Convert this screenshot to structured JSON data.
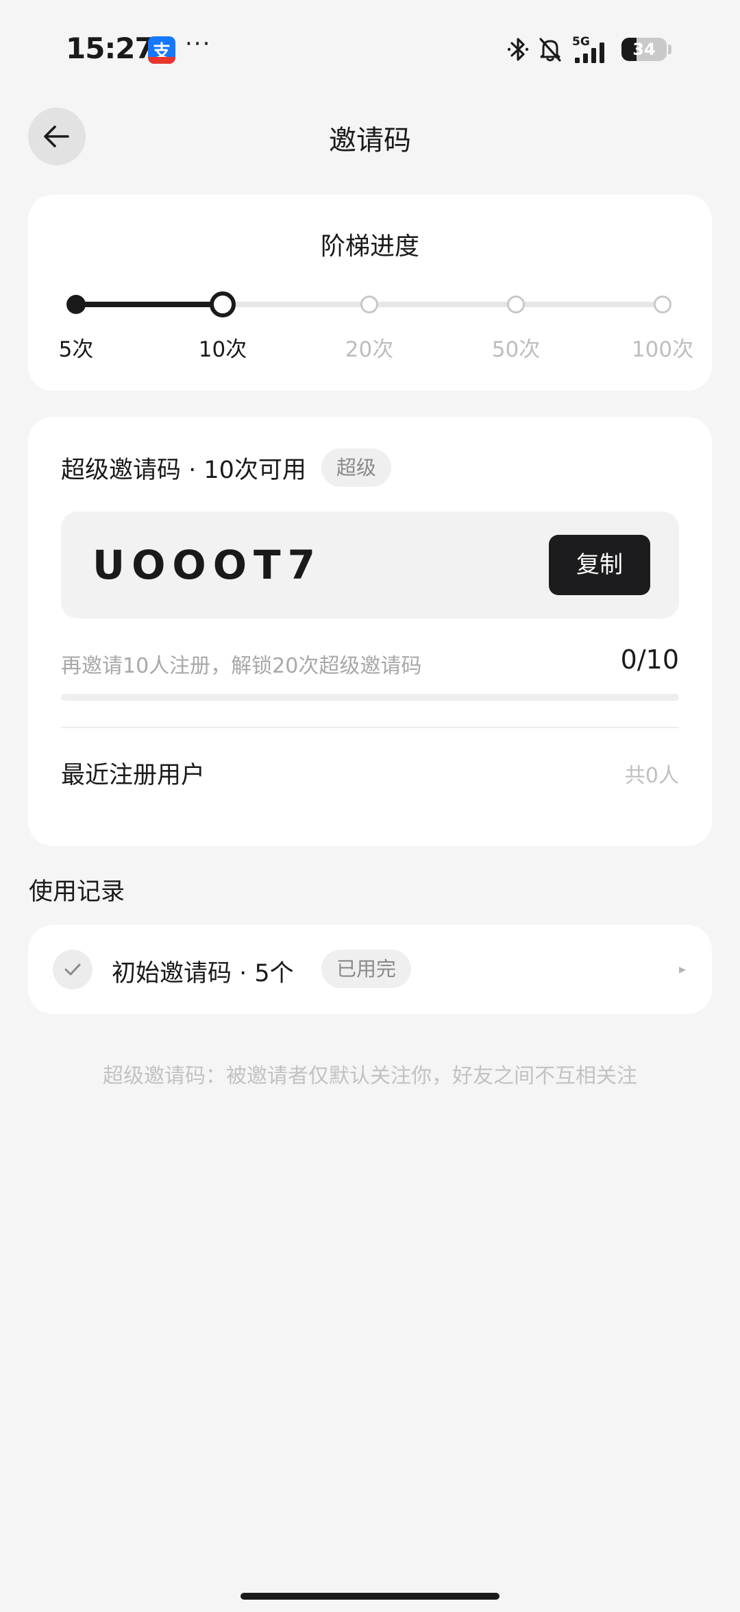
{
  "status_bar": {
    "time": "15:27",
    "app_icon_glyph": "支",
    "more": "···",
    "network": "5G",
    "battery": "34",
    "battery_level": 34
  },
  "header": {
    "title": "邀请码",
    "back_icon": "arrow-left-icon"
  },
  "progress": {
    "title": "阶梯进度",
    "tiers": [
      "5次",
      "10次",
      "20次",
      "50次",
      "100次"
    ],
    "current_index": 1
  },
  "invite_code": {
    "title": "超级邀请码 · 10次可用",
    "badge": "超级",
    "code": "UOOOT7",
    "copy_label": "复制",
    "unlock_text": "再邀请10人注册，解锁20次超级邀请码",
    "unlock_count": "0/10",
    "unlock_progress": 0,
    "recent_title": "最近注册用户",
    "recent_count": "共0人"
  },
  "records": {
    "title": "使用记录",
    "items": [
      {
        "label": "初始邀请码 · 5个",
        "status": "已用完"
      }
    ]
  },
  "footer_note": "超级邀请码：被邀请者仅默认关注你，好友之间不互相关注",
  "colors": {
    "background": "#f5f5f5",
    "card": "#ffffff",
    "primary": "#1a1a1a",
    "muted": "#bdbdbd"
  }
}
